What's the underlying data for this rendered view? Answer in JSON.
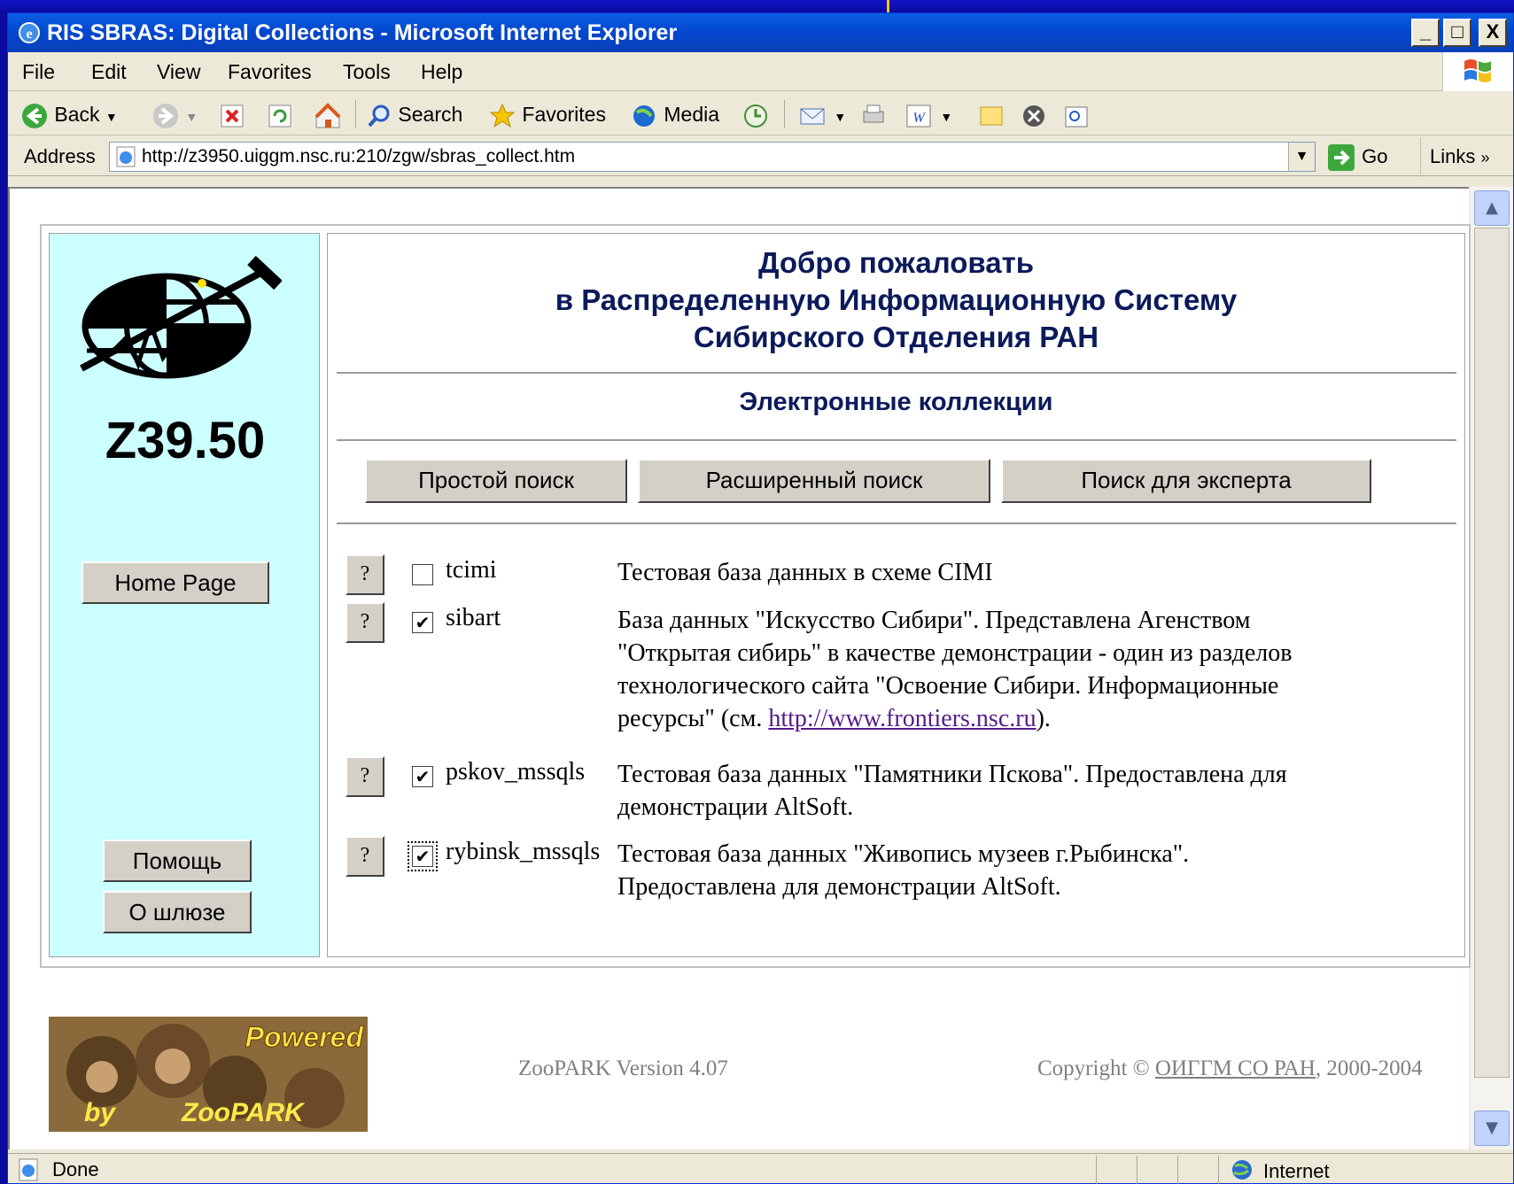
{
  "window": {
    "title": "RIS SBRAS: Digital Collections - Microsoft Internet Explorer",
    "min_label": "_",
    "max_label": "□",
    "close_label": "X"
  },
  "menu": [
    "File",
    "Edit",
    "View",
    "Favorites",
    "Tools",
    "Help"
  ],
  "toolbar": {
    "back": "Back",
    "search": "Search",
    "favorites": "Favorites",
    "media": "Media"
  },
  "address": {
    "label": "Address",
    "url": "http://z3950.uiggm.nsc.ru:210/zgw/sbras_collect.htm",
    "go": "Go",
    "links": "Links"
  },
  "sidebar": {
    "logo_text": "Z39.50",
    "home": "Home Page",
    "help": "Помощь",
    "about": "О шлюзе"
  },
  "main": {
    "welcome_line1": "Добро пожаловать",
    "welcome_line2": "в Распределенную Информационную Систему",
    "welcome_line3": "Сибирского Отделения РАН",
    "section": "Электронные коллекции",
    "tabs": [
      "Простой поиск",
      "Расширенный поиск",
      "Поиск для эксперта"
    ],
    "help_mark": "?",
    "databases": [
      {
        "name": "tcimi",
        "checked": false,
        "desc": "Тестовая база данных в схеме CIMI"
      },
      {
        "name": "sibart",
        "checked": true,
        "desc": "База данных \"Искусство Сибири\". Представлена Агенством \"Открытая сибирь\" в качестве демонстрации - один из разделов технологического сайта \"Освоение Сибири. Информационные ресурсы\" (см. ",
        "link": "http://www.frontiers.nsc.ru",
        "desc_tail": ")."
      },
      {
        "name": "pskov_mssqls",
        "checked": true,
        "desc": "Тестовая база данных \"Памятники Пскова\". Предоставлена для демонстрации AltSoft."
      },
      {
        "name": "rybinsk_mssqls",
        "checked": true,
        "desc": "Тестовая база данных \"Живопись музеев г.Рыбинска\". Предоставлена для демонстрации AltSoft."
      }
    ]
  },
  "footer": {
    "powered_1": "Powered",
    "powered_2": "by",
    "powered_3": "ZooPARK",
    "version": "ZooPARK Version 4.07",
    "copyright_prefix": "Copyright © ",
    "copyright_link": "ОИГГМ СО РАН",
    "copyright_suffix": ", 2000-2004"
  },
  "status": {
    "text": "Done",
    "zone": "Internet"
  },
  "colors": {
    "sidebar_bg": "#ccffff",
    "heading": "#0b1a5a",
    "titlebar": "#0a5fe0"
  }
}
